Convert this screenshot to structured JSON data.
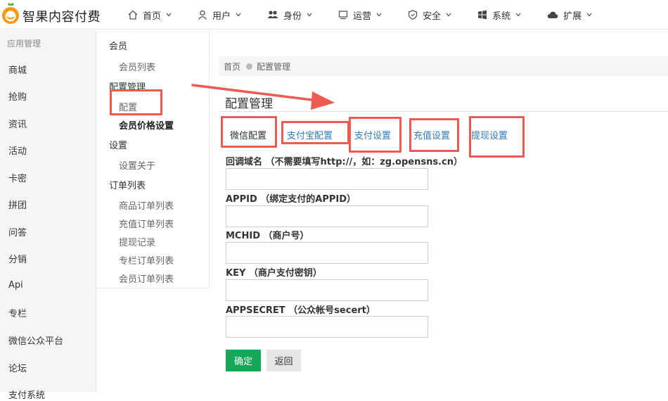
{
  "app": {
    "brand": "智果内容付费"
  },
  "nav": [
    {
      "label": "首页",
      "icon": "home-icon"
    },
    {
      "label": "用户",
      "icon": "user-icon"
    },
    {
      "label": "身份",
      "icon": "users-icon"
    },
    {
      "label": "运营",
      "icon": "monitor-icon"
    },
    {
      "label": "安全",
      "icon": "shield-icon"
    },
    {
      "label": "系统",
      "icon": "windows-icon"
    },
    {
      "label": "扩展",
      "icon": "cloud-icon"
    }
  ],
  "sidebar": {
    "heading": "应用管理",
    "items": [
      "商城",
      "抢购",
      "资讯",
      "活动",
      "卡密",
      "拼团",
      "问答",
      "分销",
      "Api",
      "专栏",
      "微信公众平台",
      "论坛",
      "支付系统"
    ]
  },
  "submenu": {
    "groups": [
      {
        "label": "会员",
        "items": [
          "会员列表"
        ]
      },
      {
        "label": "配置管理",
        "items": [
          "配置",
          "会员价格设置"
        ]
      },
      {
        "label": "设置",
        "items": [
          "设置关于"
        ]
      },
      {
        "label": "订单列表",
        "items": [
          "商品订单列表",
          "充值订单列表",
          "提现记录",
          "专栏订单列表",
          "会员订单列表"
        ]
      }
    ]
  },
  "breadcrumb": {
    "home": "首页",
    "current": "配置管理"
  },
  "page": {
    "title": "配置管理"
  },
  "tabs": [
    "微信配置",
    "支付宝配置",
    "支付设置",
    "充值设置",
    "提现设置"
  ],
  "form": {
    "fields": [
      {
        "label": "回调域名 （不需要填写http://，如：zg.opensns.cn）",
        "value": ""
      },
      {
        "label": "APPID （绑定支付的APPID）",
        "value": ""
      },
      {
        "label": "MCHID （商户号）",
        "value": ""
      },
      {
        "label": "KEY （商户支付密钥）",
        "value": ""
      },
      {
        "label": "APPSECRET （公众帐号secert）",
        "value": ""
      }
    ],
    "confirm": "确定",
    "back": "返回"
  },
  "colors": {
    "accent": "#17a65a",
    "link": "#337ab7",
    "annotation": "#ef5a50"
  }
}
